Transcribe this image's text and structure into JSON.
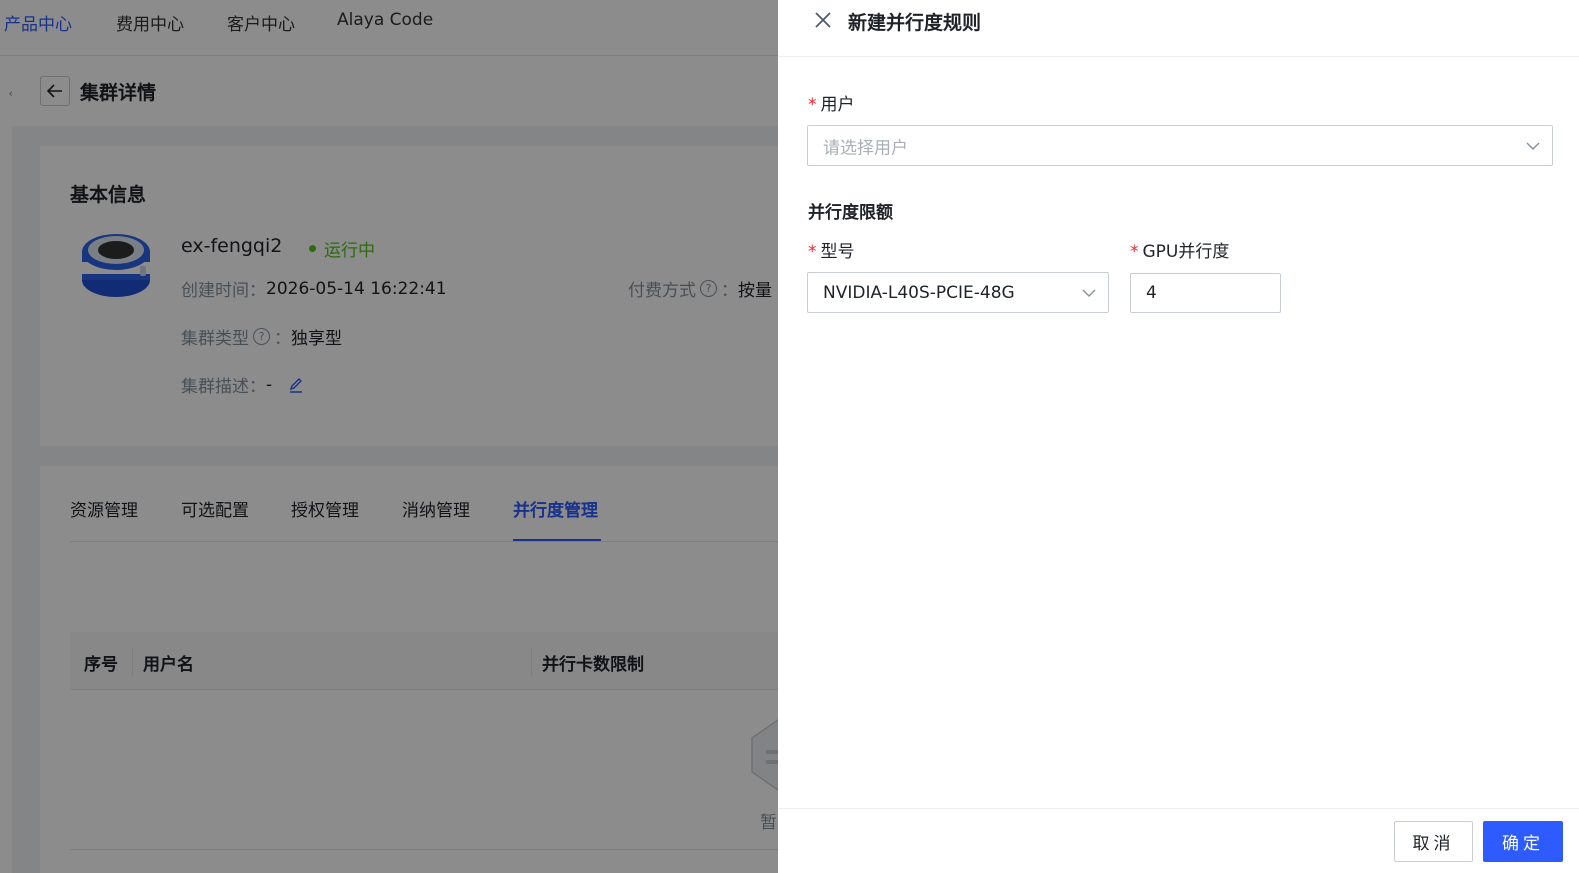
{
  "topnav": {
    "items": [
      "产品中心",
      "费用中心",
      "客户中心",
      "Alaya Code"
    ],
    "active_index": 0
  },
  "page": {
    "title": "集群详情",
    "basic_info_title": "基本信息",
    "cluster_name": "ex-fengqi2",
    "status": "运行中",
    "created_label": "创建时间",
    "created_value": "2026-05-14 16:22:41",
    "billing_label": "付费方式",
    "billing_value": "按量",
    "type_label": "集群类型",
    "type_value": "独享型",
    "desc_label": "集群描述",
    "desc_value": "-",
    "colon": "："
  },
  "tabs": [
    "资源管理",
    "可选配置",
    "授权管理",
    "消纳管理",
    "并行度管理"
  ],
  "active_tab": 4,
  "table": {
    "columns": [
      "序号",
      "用户名",
      "并行卡数限制"
    ],
    "empty_text": "暂"
  },
  "drawer": {
    "title": "新建并行度规则",
    "user_label": "用户",
    "user_placeholder": "请选择用户",
    "group_title": "并行度限额",
    "model_label": "型号",
    "model_value": "NVIDIA-L40S-PCIE-48G",
    "gpu_label": "GPU并行度",
    "gpu_value": "4",
    "required_mark": "*",
    "cancel_label": "取消",
    "ok_label": "确定"
  },
  "colors": {
    "primary": "#2d5bff",
    "status_running": "#52c41a",
    "required": "#f5222d"
  }
}
